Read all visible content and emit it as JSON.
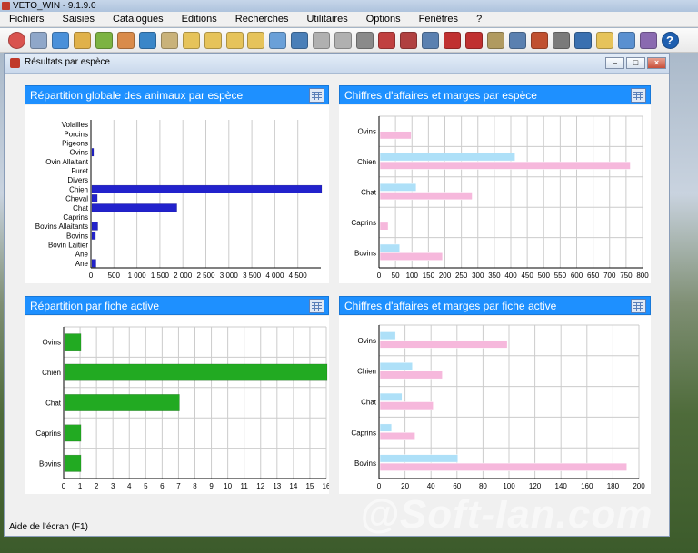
{
  "app": {
    "title": "VETO_WIN - 9.1.9.0"
  },
  "menu": [
    "Fichiers",
    "Saisies",
    "Catalogues",
    "Editions",
    "Recherches",
    "Utilitaires",
    "Options",
    "Fenêtres",
    "?"
  ],
  "toolbar": {
    "icons": [
      "exit-icon",
      "book-icon",
      "schedule-icon",
      "phone-icon",
      "people-icon",
      "animal-icon",
      "globe-icon",
      "calendar-icon",
      "folder-icon",
      "folder-icon",
      "folder-icon",
      "folder-edit-icon",
      "search-icon",
      "contact-icon",
      "invoice-icon",
      "stamp-icon",
      "printer-icon",
      "card-icon",
      "chart-icon",
      "page-icon",
      "book-stack-icon",
      "heart-icon",
      "book-open-icon",
      "users-icon",
      "home-icon",
      "tools-icon",
      "monitor-icon",
      "folder-icon",
      "pencil-icon",
      "document-icon",
      "help-icon"
    ]
  },
  "window": {
    "title": "Résultats par espèce"
  },
  "panels": {
    "p1": {
      "title": "Répartition globale des animaux par espèce"
    },
    "p2": {
      "title": "Chiffres d'affaires et marges par espèce"
    },
    "p3": {
      "title": "Répartition par fiche active"
    },
    "p4": {
      "title": "Chiffres d'affaires et marges par fiche active"
    }
  },
  "colors": {
    "blue_bar": "#2222cc",
    "green_bar": "#22aa22",
    "ca_bar": "#aee0f8",
    "marge_bar": "#f6b8dc",
    "header": "#1e90ff"
  },
  "chart_data": [
    {
      "type": "bar",
      "title": "Répartition globale des animaux par espèce",
      "categories": [
        "Volailles",
        "Porcins",
        "Pigeons",
        "Ovins",
        "Ovin Allaitant",
        "Furet",
        "Divers",
        "Chien",
        "Cheval",
        "Chat",
        "Caprins",
        "Bovins Allaitants",
        "Bovins",
        "Bovin Laitier",
        "Ane",
        "Ane"
      ],
      "values": [
        0,
        0,
        0,
        40,
        0,
        0,
        0,
        5000,
        120,
        1850,
        0,
        130,
        80,
        0,
        0,
        90
      ],
      "xticks": [
        "0",
        "500",
        "1 000",
        "1 500",
        "2 000",
        "2 500",
        "3 000",
        "3 500",
        "4 000",
        "4 500"
      ],
      "xlim": [
        0,
        5000
      ],
      "orientation": "horizontal",
      "grid": true
    },
    {
      "type": "bar",
      "title": "Chiffres d'affaires et marges par espèce",
      "categories": [
        "Ovins",
        "Chien",
        "Chat",
        "Caprins",
        "Bovins"
      ],
      "series": [
        {
          "values": [
            0,
            410,
            110,
            0,
            60
          ]
        },
        {
          "values": [
            95,
            760,
            280,
            25,
            190
          ]
        }
      ],
      "xticks": [
        "0",
        "50",
        "100",
        "150",
        "200",
        "250",
        "300",
        "350",
        "400",
        "450",
        "500",
        "550",
        "600",
        "650",
        "700",
        "750",
        "800"
      ],
      "xlim": [
        0,
        800
      ],
      "orientation": "horizontal",
      "grid": true
    },
    {
      "type": "bar",
      "title": "Répartition par fiche active",
      "categories": [
        "Ovins",
        "Chien",
        "Chat",
        "Caprins",
        "Bovins"
      ],
      "values": [
        1,
        16,
        7,
        1,
        1
      ],
      "xticks": [
        "0",
        "1",
        "2",
        "3",
        "4",
        "5",
        "6",
        "7",
        "8",
        "9",
        "10",
        "11",
        "12",
        "13",
        "14",
        "15",
        "16"
      ],
      "xlim": [
        0,
        16
      ],
      "orientation": "horizontal",
      "grid": true
    },
    {
      "type": "bar",
      "title": "Chiffres d'affaires et marges par fiche active",
      "categories": [
        "Ovins",
        "Chien",
        "Chat",
        "Caprins",
        "Bovins"
      ],
      "series": [
        {
          "values": [
            12,
            25,
            17,
            9,
            60
          ]
        },
        {
          "values": [
            98,
            48,
            41,
            27,
            190
          ]
        }
      ],
      "xticks": [
        "0",
        "20",
        "40",
        "60",
        "80",
        "100",
        "120",
        "140",
        "160",
        "180",
        "200"
      ],
      "xlim": [
        0,
        200
      ],
      "orientation": "horizontal",
      "grid": true
    }
  ],
  "status": {
    "text": "Aide de l'écran (F1)"
  },
  "watermark": "@Soft-Ian.com"
}
